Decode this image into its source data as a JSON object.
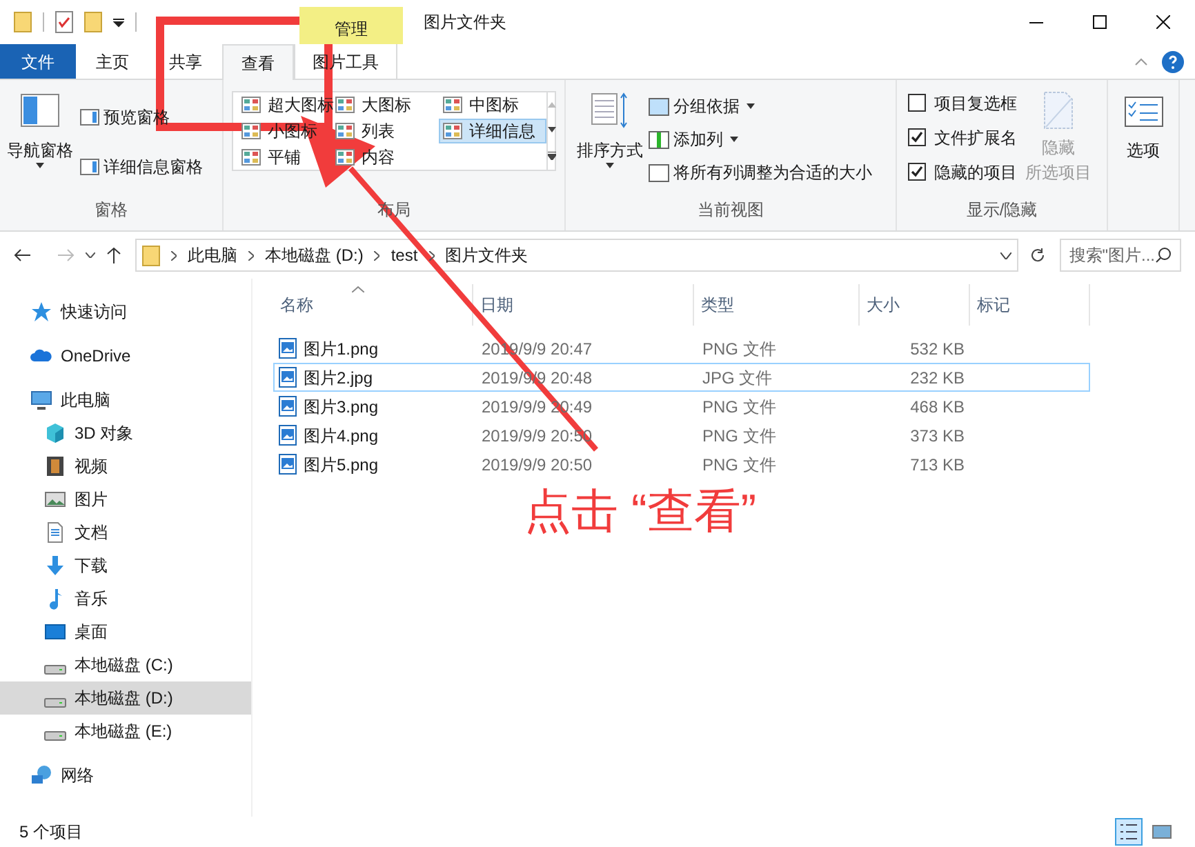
{
  "window": {
    "title": "图片文件夹",
    "context_tab": "管理"
  },
  "tabs": [
    {
      "label": "文件",
      "kind": "file",
      "selected": false
    },
    {
      "label": "主页",
      "kind": "tab",
      "selected": false
    },
    {
      "label": "共享",
      "kind": "tab",
      "selected": false
    },
    {
      "label": "查看",
      "kind": "tab",
      "selected": true
    },
    {
      "label": "图片工具",
      "kind": "tab",
      "selected": false
    }
  ],
  "ribbon": {
    "panes": {
      "label": "窗格",
      "nav": "导航窗格",
      "preview": "预览窗格",
      "details": "详细信息窗格"
    },
    "layout": {
      "label": "布局",
      "options": [
        {
          "label": "超大图标",
          "selected": false
        },
        {
          "label": "大图标",
          "selected": false
        },
        {
          "label": "中图标",
          "selected": false
        },
        {
          "label": "小图标",
          "selected": false
        },
        {
          "label": "列表",
          "selected": false
        },
        {
          "label": "详细信息",
          "selected": true
        },
        {
          "label": "平铺",
          "selected": false
        },
        {
          "label": "内容",
          "selected": false
        }
      ]
    },
    "current_view": {
      "label": "当前视图",
      "sort": "排序方式",
      "group": "分组依据",
      "add_column": "添加列",
      "fit": "将所有列调整为合适的大小"
    },
    "show_hide": {
      "label": "显示/隐藏",
      "checkboxes": [
        {
          "label": "项目复选框",
          "checked": false
        },
        {
          "label": "文件扩展名",
          "checked": true
        },
        {
          "label": "隐藏的项目",
          "checked": true
        }
      ],
      "hide_selected": "隐藏",
      "hide_selected_2": "所选项目"
    },
    "options": {
      "label": "选项"
    }
  },
  "address": {
    "crumbs": [
      "此电脑",
      "本地磁盘 (D:)",
      "test",
      "图片文件夹"
    ],
    "search_placeholder": "搜索\"图片..."
  },
  "sidebar": {
    "items": [
      {
        "label": "快速访问",
        "kind": "star",
        "selected": false
      },
      {
        "label": "OneDrive",
        "kind": "cloud",
        "selected": false
      },
      {
        "label": "此电脑",
        "kind": "pc",
        "selected": false,
        "children": [
          {
            "label": "3D 对象",
            "kind": "cube",
            "selected": false
          },
          {
            "label": "视频",
            "kind": "video",
            "selected": false
          },
          {
            "label": "图片",
            "kind": "image",
            "selected": false
          },
          {
            "label": "文档",
            "kind": "doc",
            "selected": false
          },
          {
            "label": "下载",
            "kind": "download",
            "selected": false
          },
          {
            "label": "音乐",
            "kind": "music",
            "selected": false
          },
          {
            "label": "桌面",
            "kind": "desktop",
            "selected": false
          },
          {
            "label": "本地磁盘 (C:)",
            "kind": "drive",
            "selected": false
          },
          {
            "label": "本地磁盘 (D:)",
            "kind": "drive",
            "selected": true
          },
          {
            "label": "本地磁盘 (E:)",
            "kind": "drive",
            "selected": false
          }
        ]
      },
      {
        "label": "网络",
        "kind": "network",
        "selected": false
      }
    ]
  },
  "table": {
    "columns": [
      {
        "label": "名称",
        "sorted": true
      },
      {
        "label": "日期",
        "sorted": false
      },
      {
        "label": "类型",
        "sorted": false
      },
      {
        "label": "大小",
        "sorted": false
      },
      {
        "label": "标记",
        "sorted": false
      }
    ],
    "rows": [
      {
        "name": "图片1.png",
        "date": "2019/9/9 20:47",
        "type": "PNG 文件",
        "size": "532 KB",
        "selected": false
      },
      {
        "name": "图片2.jpg",
        "date": "2019/9/9 20:48",
        "type": "JPG 文件",
        "size": "232 KB",
        "selected": true
      },
      {
        "name": "图片3.png",
        "date": "2019/9/9 20:49",
        "type": "PNG 文件",
        "size": "468 KB",
        "selected": false
      },
      {
        "name": "图片4.png",
        "date": "2019/9/9 20:50",
        "type": "PNG 文件",
        "size": "373 KB",
        "selected": false
      },
      {
        "name": "图片5.png",
        "date": "2019/9/9 20:50",
        "type": "PNG 文件",
        "size": "713 KB",
        "selected": false
      }
    ]
  },
  "status_bar": {
    "count": "5 个项目",
    "views": [
      {
        "kind": "details",
        "selected": true
      },
      {
        "kind": "thumbnails",
        "selected": false
      }
    ]
  },
  "annotation": {
    "text": "点击 “查看”"
  }
}
